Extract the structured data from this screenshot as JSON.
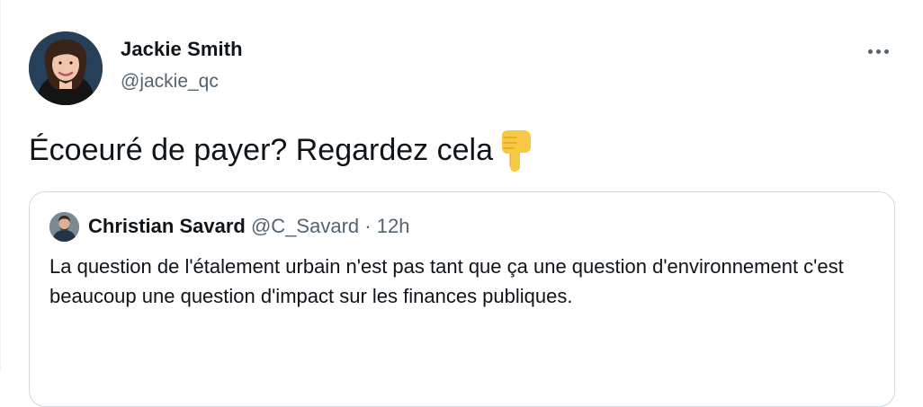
{
  "tweet": {
    "author": {
      "display_name": "Jackie Smith",
      "handle": "@jackie_qc"
    },
    "text": "Écoeuré de payer? Regardez cela",
    "emoji": "backhand-index-pointing-down",
    "more_icon": "more-horizontal-icon"
  },
  "quoted_tweet": {
    "author": {
      "display_name": "Christian Savard",
      "handle": "@C_Savard"
    },
    "separator": "·",
    "time": "12h",
    "text": "La question de l'étalement urbain n'est pas tant que ça une question d'environnement c'est beaucoup une question d'impact sur les finances publiques."
  },
  "colors": {
    "primary_text": "#0f1419",
    "secondary_text": "#536471",
    "border": "#cfd9de",
    "emoji": "#f7c844"
  }
}
